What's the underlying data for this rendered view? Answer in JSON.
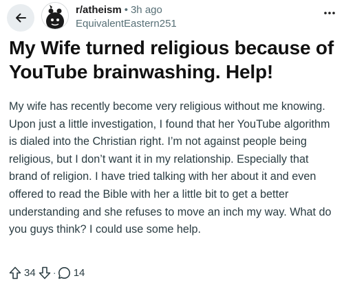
{
  "post": {
    "subreddit": "r/atheism",
    "separator": "•",
    "time_ago": "3h ago",
    "author": "EquivalentEastern251",
    "title": "My Wife turned religious because of YouTube brainwashing. Help!",
    "body": "My wife has recently become very religious without me knowing. Upon just a little investigation, I found that her YouTube algorithm is dialed into the Christian right. I’m not against people being religious, but I don’t want it in my relationship. Especially that brand of religion. I have tried talking with her about it and even offered to read the Bible with her a little bit to get a better understanding and she refuses to move an inch my way. What do you guys think? I could use some help."
  },
  "actions": {
    "upvotes": "34",
    "separator": "·",
    "comments": "14"
  },
  "icons": {
    "back": "back-arrow-icon",
    "more": "more-options-icon",
    "upvote": "upvote-arrow-icon",
    "downvote": "downvote-arrow-icon",
    "comment": "comment-bubble-icon",
    "avatar": "subreddit-avatar-icon"
  },
  "colors": {
    "back_button_bg": "#e9edf0",
    "meta_gray": "#576f76",
    "body_text": "#2a3c42"
  }
}
